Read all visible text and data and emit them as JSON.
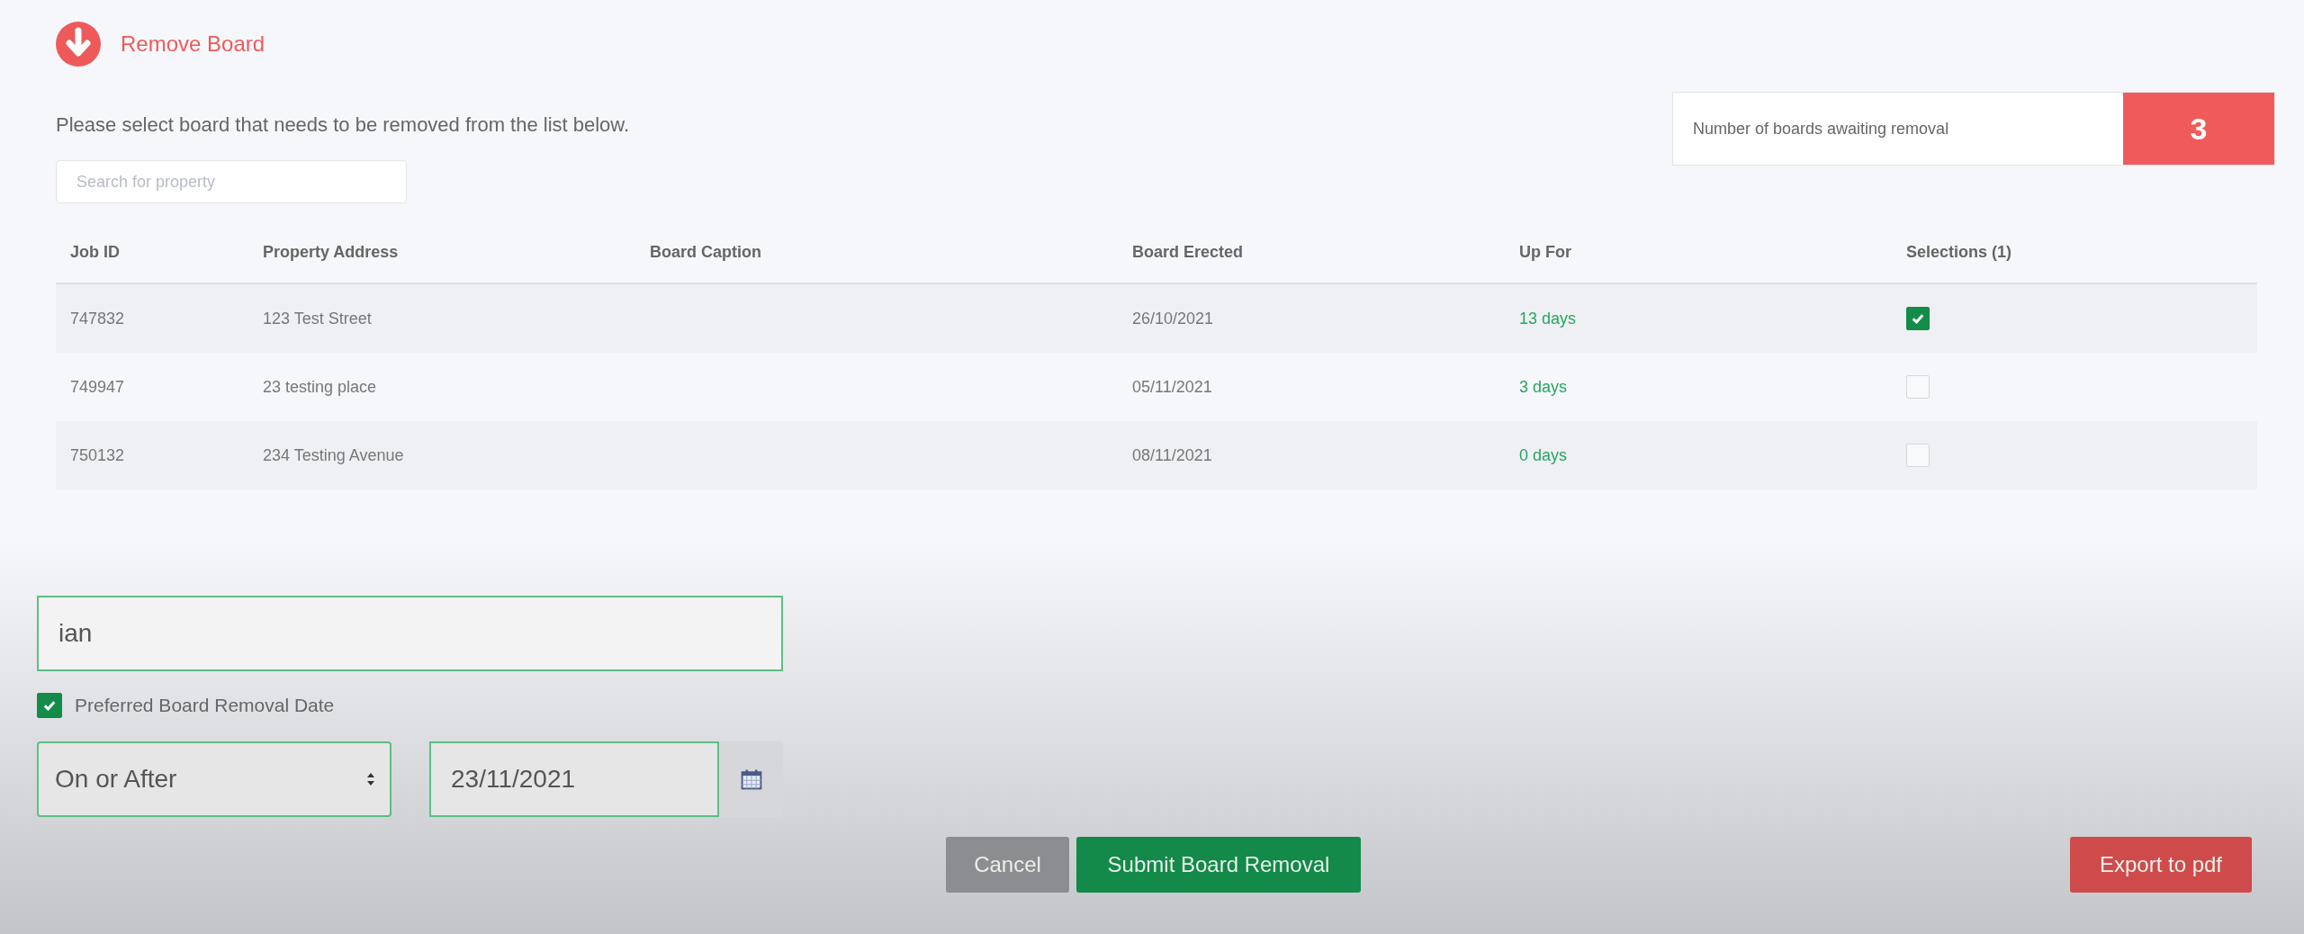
{
  "header": {
    "title": "Remove Board"
  },
  "instruction": "Please select board that needs to be removed from the list below.",
  "counter": {
    "label": "Number of boards awaiting removal",
    "value": "3"
  },
  "search": {
    "placeholder": "Search for property"
  },
  "table": {
    "columns": [
      "Job ID",
      "Property Address",
      "Board Caption",
      "Board Erected",
      "Up For",
      "Selections (1)"
    ],
    "rows": [
      {
        "job_id": "747832",
        "address": "123 Test Street",
        "erected": "26/10/2021",
        "up_for": "13 days",
        "checked": true
      },
      {
        "job_id": "749947",
        "address": "23 testing place",
        "erected": "05/11/2021",
        "up_for": "3 days",
        "checked": false
      },
      {
        "job_id": "750132",
        "address": "234 Testing Avenue",
        "erected": "08/11/2021",
        "up_for": "0 days",
        "checked": false
      }
    ]
  },
  "name_field": {
    "value": "ian"
  },
  "preferred_date": {
    "label": "Preferred Board Removal Date",
    "checked": true
  },
  "date_mode": {
    "value": "On or After"
  },
  "date_field": {
    "value": "23/11/2021"
  },
  "buttons": [
    {
      "label": "Cancel",
      "kind": "cancel"
    },
    {
      "label": "Submit Board Removal",
      "kind": "submit"
    },
    {
      "label": "Export to pdf",
      "kind": "export"
    }
  ]
}
